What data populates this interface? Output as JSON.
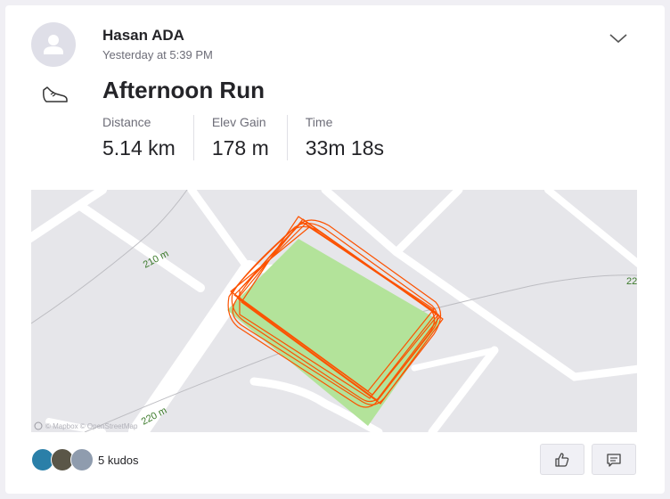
{
  "athlete": {
    "name": "Hasan ADA",
    "timestamp": "Yesterday at 5:39 PM"
  },
  "activity": {
    "type_icon": "running-shoe-icon",
    "title": "Afternoon Run",
    "stats": [
      {
        "label": "Distance",
        "value": "5.14 km"
      },
      {
        "label": "Elev Gain",
        "value": "178 m"
      },
      {
        "label": "Time",
        "value": "33m 18s"
      }
    ]
  },
  "map": {
    "contour_labels": [
      "210 m",
      "220 m",
      "22"
    ],
    "attribution": "© Mapbox © OpenStreetMap",
    "route_color": "#fc5200",
    "park_color": "#b3e39a"
  },
  "social": {
    "kudos_text": "5 kudos",
    "kudos_icon": "thumbs-up-icon",
    "comment_icon": "comment-icon"
  }
}
